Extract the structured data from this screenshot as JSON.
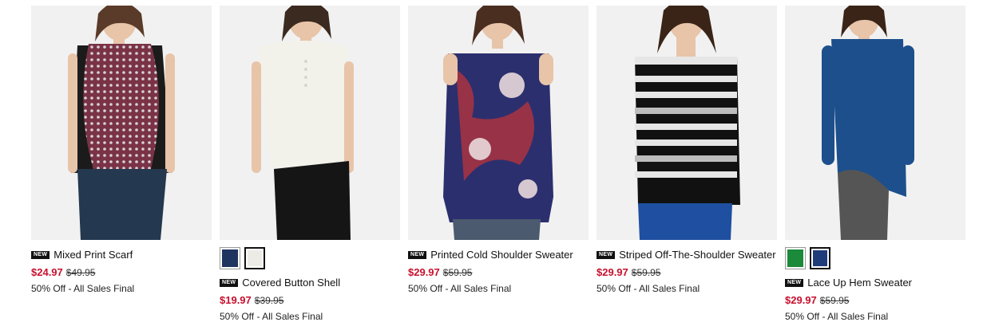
{
  "products": [
    {
      "badge": "NEW",
      "name": "Mixed Print Scarf",
      "sale_price": "$24.97",
      "original_price": "$49.95",
      "promo": "50% Off - All Sales Final",
      "colors": {
        "top": "#7a3346",
        "side": "#1b1b1b",
        "pants": "#24384f"
      }
    },
    {
      "badge": "NEW",
      "name": "Covered Button Shell",
      "sale_price": "$19.97",
      "original_price": "$39.95",
      "promo": "50% Off - All Sales Final",
      "swatches": [
        "#1f3560",
        "#ecebe6"
      ],
      "colors": {
        "top": "#f3f2ea",
        "pants": "#151515"
      }
    },
    {
      "badge": "NEW",
      "name": "Printed Cold Shoulder Sweater",
      "sale_price": "$29.97",
      "original_price": "$59.95",
      "promo": "50% Off - All Sales Final",
      "colors": {
        "top": "#2b2f6e",
        "accent": "#b4333d",
        "pants": "#4b5a6e"
      }
    },
    {
      "badge": "NEW",
      "name": "Striped Off-The-Shoulder Sweater",
      "sale_price": "$29.97",
      "original_price": "$59.95",
      "promo": "50% Off - All Sales Final",
      "colors": {
        "top": "#111111",
        "stripe": "#e6e6e6",
        "pants": "#1f4fa0"
      }
    },
    {
      "badge": "NEW",
      "name": "Lace Up Hem Sweater",
      "sale_price": "$29.97",
      "original_price": "$59.95",
      "promo": "50% Off - All Sales Final",
      "swatches": [
        "#1b8a3a",
        "#1e3b7a"
      ],
      "colors": {
        "top": "#1d4f8c",
        "pants": "#555555"
      }
    }
  ]
}
